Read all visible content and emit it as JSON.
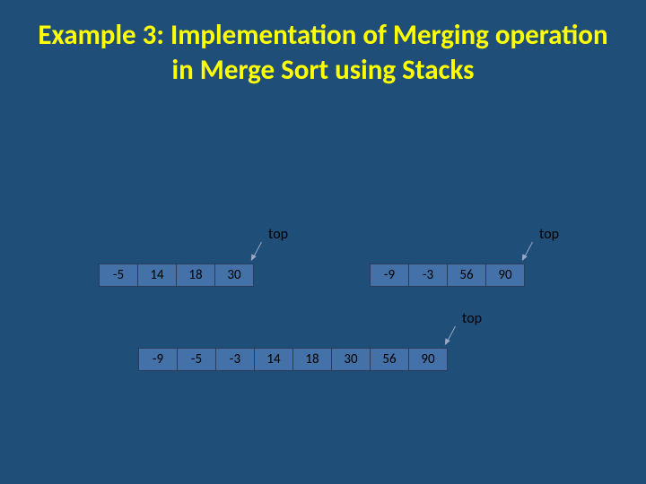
{
  "title": "Example 3: Implementation of Merging operation in Merge Sort using Stacks",
  "labels": {
    "top1": "top",
    "top2": "top",
    "top3": "top"
  },
  "stackA": [
    "-5",
    "14",
    "18",
    "30"
  ],
  "stackB": [
    "-9",
    "-3",
    "56",
    "90"
  ],
  "stackC": [
    "-9",
    "-5",
    "-3",
    "14",
    "18",
    "30",
    "56",
    "90"
  ]
}
